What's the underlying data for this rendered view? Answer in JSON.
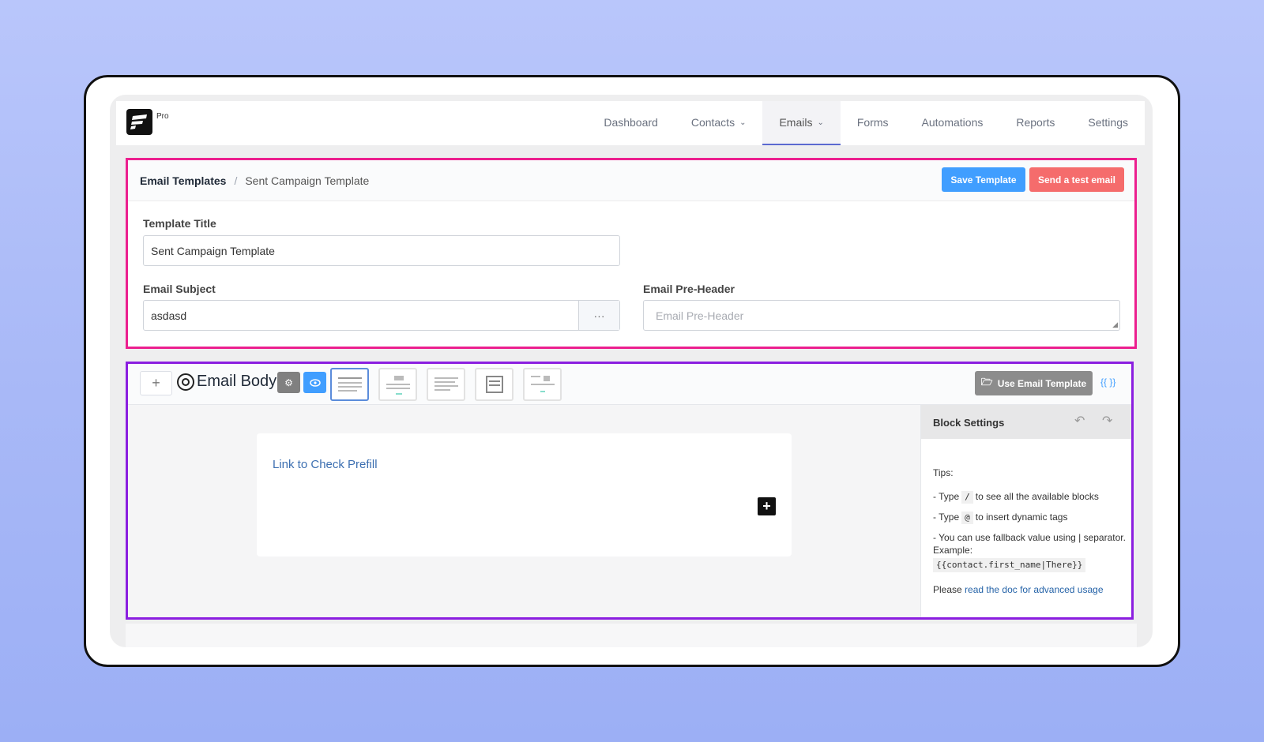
{
  "brand": {
    "tag": "Pro"
  },
  "nav": {
    "items": [
      {
        "label": "Dashboard"
      },
      {
        "label": "Contacts"
      },
      {
        "label": "Emails"
      },
      {
        "label": "Forms"
      },
      {
        "label": "Automations"
      },
      {
        "label": "Reports"
      },
      {
        "label": "Settings"
      }
    ],
    "active": "Emails"
  },
  "breadcrumb": {
    "first": "Email Templates",
    "sep": "/",
    "current": "Sent Campaign Template"
  },
  "actions": {
    "save_label": "Save Template",
    "test_label": "Send a test email"
  },
  "form": {
    "title_label": "Template Title",
    "title_value": "Sent Campaign Template",
    "subject_label": "Email Subject",
    "subject_value": "asdasd",
    "subject_more": "···",
    "preheader_label": "Email Pre-Header",
    "preheader_placeholder": "Email Pre-Header"
  },
  "editor": {
    "add_symbol": "+",
    "title": "Email Body",
    "use_template_label": "Use Email Template",
    "curly": "{{ }}",
    "layouts": [
      "plain",
      "image-header",
      "simple-text",
      "document",
      "code-image"
    ]
  },
  "canvas": {
    "link_text": "Link to Check Prefill",
    "add_symbol": "+"
  },
  "sidebar": {
    "title": "Block Settings",
    "tips_title": "Tips:",
    "tip1_pre": "- Type",
    "tip1_key": "/",
    "tip1_post": "to see all the available blocks",
    "tip2_pre": "- Type",
    "tip2_key": "@",
    "tip2_post": "to insert dynamic tags",
    "tip3": "- You can use fallback value using | separator. Example:",
    "tip3_code": "{{contact.first_name|There}}",
    "doc_pre": "Please",
    "doc_link": "read the doc for advanced usage"
  },
  "colors": {
    "primary": "#409eff",
    "danger": "#f56c6c",
    "highlight_pink": "#ec1f8f",
    "highlight_purple": "#8b1ee0"
  }
}
